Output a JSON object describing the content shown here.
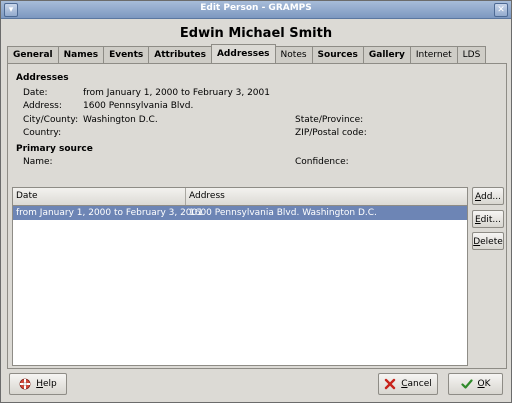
{
  "window": {
    "title": "Edit Person - GRAMPS"
  },
  "person": {
    "name": "Edwin Michael Smith"
  },
  "tabs": [
    {
      "label": "General"
    },
    {
      "label": "Names"
    },
    {
      "label": "Events"
    },
    {
      "label": "Attributes"
    },
    {
      "label": "Addresses"
    },
    {
      "label": "Notes"
    },
    {
      "label": "Sources"
    },
    {
      "label": "Gallery"
    },
    {
      "label": "Internet"
    },
    {
      "label": "LDS"
    }
  ],
  "active_tab": "Addresses",
  "addresses": {
    "heading": "Addresses",
    "date_label": "Date:",
    "date_value": "from January 1, 2000 to February 3, 2001",
    "address_label": "Address:",
    "address_value": "1600 Pennsylvania Blvd.",
    "city_label": "City/County:",
    "city_value": "Washington D.C.",
    "state_label": "State/Province:",
    "country_label": "Country:",
    "zip_label": "ZIP/Postal code:"
  },
  "primary_source": {
    "heading": "Primary source",
    "name_label": "Name:",
    "confidence_label": "Confidence:"
  },
  "list": {
    "columns": [
      "Date",
      "Address"
    ],
    "rows": [
      {
        "date": "from January 1, 2000 to February 3, 2001",
        "address": "1600 Pennsylvania Blvd. Washington D.C."
      }
    ]
  },
  "buttons": {
    "add": {
      "prefix": "",
      "mnemonic": "A",
      "rest": "dd..."
    },
    "edit": {
      "prefix": "",
      "mnemonic": "E",
      "rest": "dit..."
    },
    "delete": {
      "prefix": "",
      "mnemonic": "D",
      "rest": "elete"
    },
    "help": {
      "mnemonic": "H",
      "rest": "elp"
    },
    "cancel": {
      "mnemonic": "C",
      "rest": "ancel"
    },
    "ok": {
      "mnemonic": "O",
      "rest": "K"
    }
  },
  "icons": {
    "help": "lifebuoy-icon",
    "cancel": "red-x-icon",
    "ok": "green-check-icon"
  },
  "colors": {
    "selection": "#6d85b5",
    "titlebar": "#7d98c0"
  }
}
